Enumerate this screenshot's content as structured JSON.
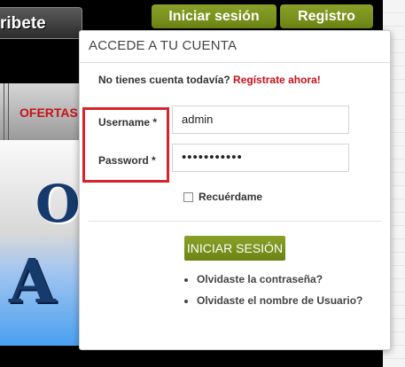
{
  "brand": {
    "partial_text": "ribete"
  },
  "header": {
    "login_button": "Iniciar sesión",
    "register_button": "Registro"
  },
  "nav": {
    "item": "OFERTAS"
  },
  "banner": {
    "line1": "O",
    "line2": "A"
  },
  "login": {
    "title": "ACCEDE A TU CUENTA",
    "no_account_text": "No tienes cuenta todavía?",
    "register_link": "Regístrate ahora!",
    "username_label": "Username *",
    "username_value": "admin",
    "password_label": "Password *",
    "password_value": "•••••••••••",
    "remember_label": "Recuérdame",
    "submit_label": "INICIAR SESIÓN",
    "links": [
      "Olvidaste la contraseña?",
      "Olvidaste el nombre de Usuario?"
    ]
  },
  "colors": {
    "accent_green": "#7a9320",
    "highlight_red": "#d8232a",
    "link_red": "#c8101a"
  }
}
